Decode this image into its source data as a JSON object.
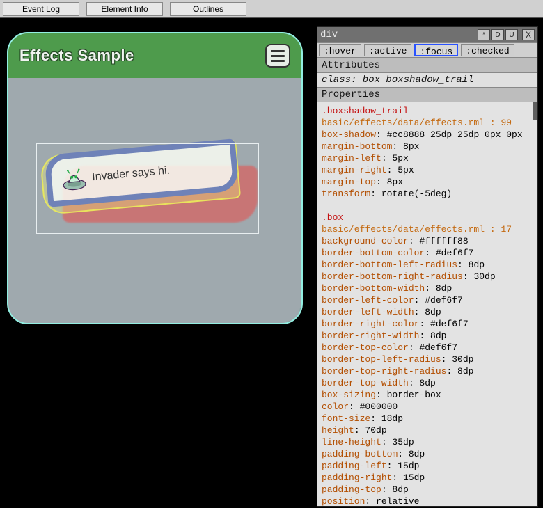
{
  "toolbar": {
    "event_log": "Event Log",
    "element_info": "Element Info",
    "outlines": "Outlines"
  },
  "sample": {
    "title": "Effects Sample",
    "box_text": "Invader says hi."
  },
  "inspector": {
    "tag": "div",
    "buttons": {
      "star": "*",
      "d": "D",
      "u": "U",
      "close": "X"
    },
    "pseudo": {
      "hover": ":hover",
      "active": ":active",
      "focus": ":focus",
      "checked": ":checked"
    },
    "attributes_hdr": "Attributes",
    "attr_line": "class: box boxshadow_trail",
    "properties_hdr": "Properties",
    "rules": [
      {
        "selector": ".boxshadow_trail",
        "source": "basic/effects/data/effects.rml : 99",
        "props": [
          [
            "box-shadow",
            "#cc8888 25dp 25dp 0px 0px"
          ],
          [
            "margin-bottom",
            "8px"
          ],
          [
            "margin-left",
            "5px"
          ],
          [
            "margin-right",
            "5px"
          ],
          [
            "margin-top",
            "8px"
          ],
          [
            "transform",
            "rotate(-5deg)"
          ]
        ]
      },
      {
        "selector": ".box",
        "source": "basic/effects/data/effects.rml : 17",
        "props": [
          [
            "background-color",
            "#ffffff88"
          ],
          [
            "border-bottom-color",
            "#def6f7"
          ],
          [
            "border-bottom-left-radius",
            "8dp"
          ],
          [
            "border-bottom-right-radius",
            "30dp"
          ],
          [
            "border-bottom-width",
            "8dp"
          ],
          [
            "border-left-color",
            "#def6f7"
          ],
          [
            "border-left-width",
            "8dp"
          ],
          [
            "border-right-color",
            "#def6f7"
          ],
          [
            "border-right-width",
            "8dp"
          ],
          [
            "border-top-color",
            "#def6f7"
          ],
          [
            "border-top-left-radius",
            "30dp"
          ],
          [
            "border-top-right-radius",
            "8dp"
          ],
          [
            "border-top-width",
            "8dp"
          ],
          [
            "box-sizing",
            "border-box"
          ],
          [
            "color",
            "#000000"
          ],
          [
            "font-size",
            "18dp"
          ],
          [
            "height",
            "70dp"
          ],
          [
            "line-height",
            "35dp"
          ],
          [
            "padding-bottom",
            "8dp"
          ],
          [
            "padding-left",
            "15dp"
          ],
          [
            "padding-right",
            "15dp"
          ],
          [
            "padding-top",
            "8dp"
          ],
          [
            "position",
            "relative"
          ]
        ]
      }
    ]
  }
}
